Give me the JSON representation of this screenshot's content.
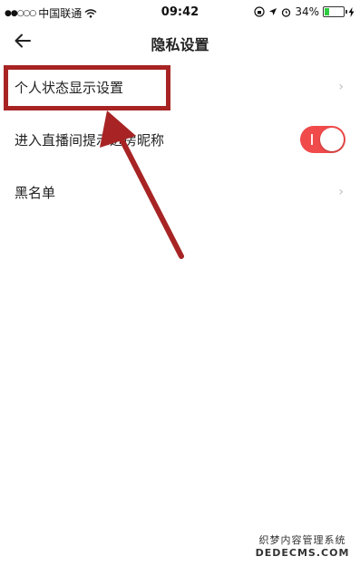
{
  "status_bar": {
    "signal": "●●○○○",
    "carrier": "中国联通",
    "time": "09:42",
    "battery": "34%",
    "battery_level": 0.34
  },
  "nav": {
    "title": "隐私设置"
  },
  "settings": {
    "items": [
      {
        "label": "个人状态显示设置",
        "control": "chevron"
      },
      {
        "label": "进入直播间提示进房昵称",
        "control": "toggle",
        "enabled": true
      },
      {
        "label": "黑名单",
        "control": "chevron"
      }
    ]
  },
  "colors": {
    "toggle_on": "#f04a4a",
    "annotation": "#a82424"
  },
  "watermark": {
    "line1": "织梦内容管理系统",
    "line2": "DEDECMS.COM"
  }
}
